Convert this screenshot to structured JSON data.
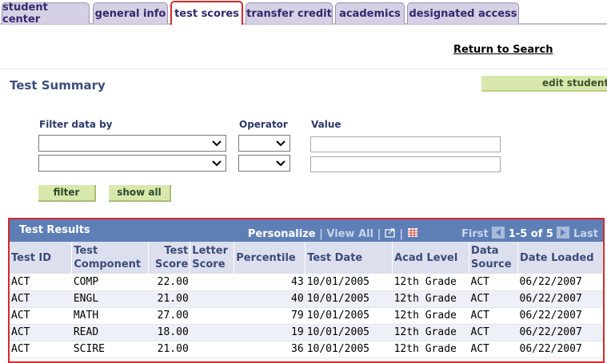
{
  "tabs": [
    {
      "label": "student center"
    },
    {
      "label": "general info"
    },
    {
      "label": "test scores"
    },
    {
      "label": "transfer credit"
    },
    {
      "label": "academics"
    },
    {
      "label": "designated access"
    }
  ],
  "return_link": "Return to Search",
  "page_title": "Test Summary",
  "edit_button": "edit student",
  "filter": {
    "filter_by_label": "Filter data by",
    "operator_label": "Operator",
    "value_label": "Value",
    "filter_button": "filter",
    "show_all_button": "show all"
  },
  "grid": {
    "title": "Test Results",
    "personalize": "Personalize",
    "sep": "|",
    "view_all": "View All",
    "first": "First",
    "range": "1-5 of 5",
    "last": "Last",
    "columns": [
      {
        "line1": "Test ID",
        "line2": ""
      },
      {
        "line1": "Test",
        "line2": "Component"
      },
      {
        "line1": "Test",
        "line2": "Score"
      },
      {
        "line1": "Letter",
        "line2": "Score"
      },
      {
        "line1": "Percentile",
        "line2": ""
      },
      {
        "line1": "Test Date",
        "line2": ""
      },
      {
        "line1": "Acad Level",
        "line2": ""
      },
      {
        "line1": "Data",
        "line2": "Source"
      },
      {
        "line1": "Date Loaded",
        "line2": ""
      }
    ],
    "rows": [
      {
        "id": "ACT",
        "component": "COMP",
        "score": "22.00",
        "letter": "",
        "percentile": "43",
        "date": "10/01/2005",
        "level": "12th Grade",
        "source": "ACT",
        "loaded": "06/22/2007"
      },
      {
        "id": "ACT",
        "component": "ENGL",
        "score": "21.00",
        "letter": "",
        "percentile": "40",
        "date": "10/01/2005",
        "level": "12th Grade",
        "source": "ACT",
        "loaded": "06/22/2007"
      },
      {
        "id": "ACT",
        "component": "MATH",
        "score": "27.00",
        "letter": "",
        "percentile": "79",
        "date": "10/01/2005",
        "level": "12th Grade",
        "source": "ACT",
        "loaded": "06/22/2007"
      },
      {
        "id": "ACT",
        "component": "READ",
        "score": "18.00",
        "letter": "",
        "percentile": "19",
        "date": "10/01/2005",
        "level": "12th Grade",
        "source": "ACT",
        "loaded": "06/22/2007"
      },
      {
        "id": "ACT",
        "component": "SCIRE",
        "score": "21.00",
        "letter": "",
        "percentile": "36",
        "date": "10/01/2005",
        "level": "12th Grade",
        "source": "ACT",
        "loaded": "06/22/2007"
      }
    ]
  }
}
